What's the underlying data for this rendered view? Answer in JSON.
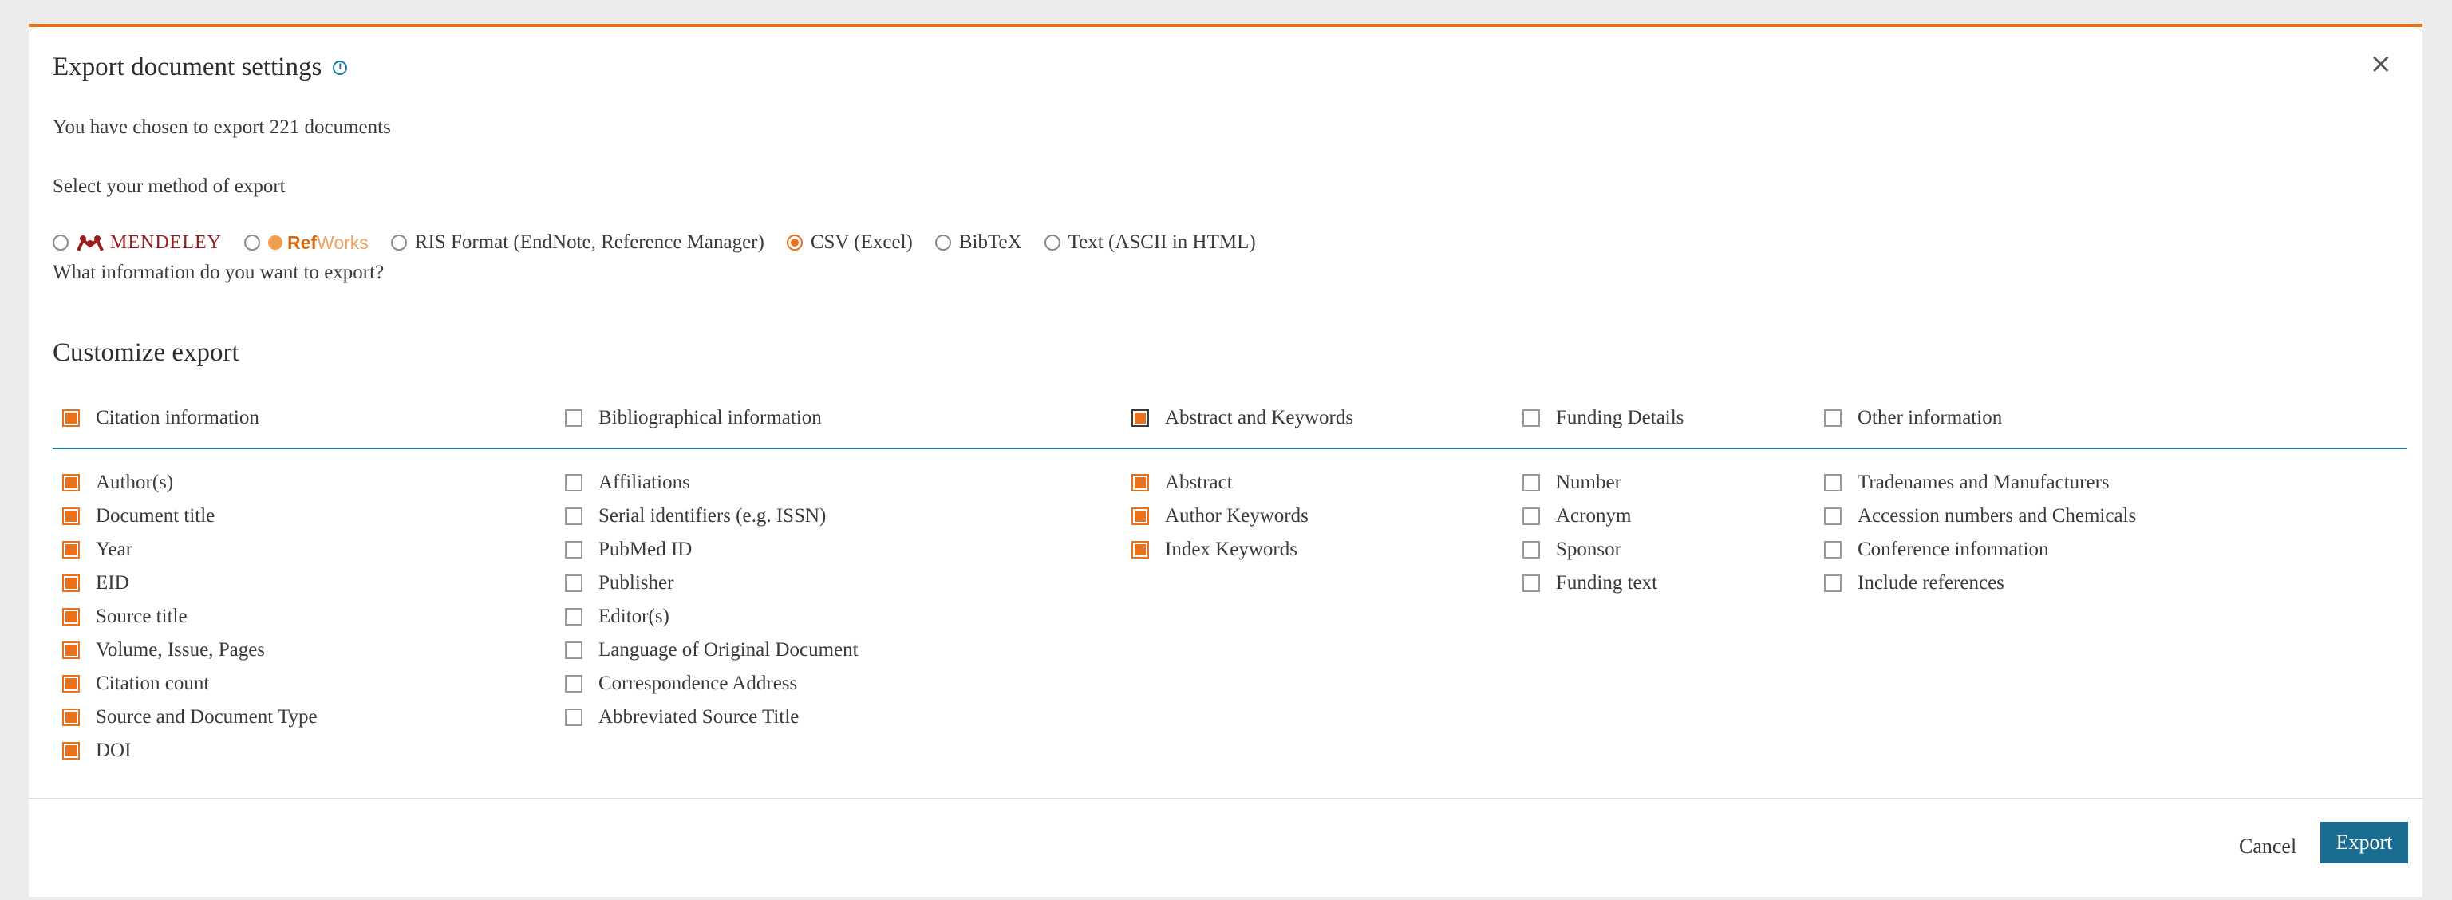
{
  "dialog": {
    "title": "Export document settings",
    "close_glyph": "×",
    "chosen_text": "You have chosen to export 221 documents",
    "select_method_text": "Select your method of export",
    "what_info_text": "What information do you want to export?",
    "customize_title": "Customize export"
  },
  "methods": {
    "mendeley": "MENDELEY",
    "refworks_ref": "Ref",
    "refworks_works": "Works",
    "ris": "RIS Format (EndNote, Reference Manager)",
    "csv": "CSV (Excel)",
    "bibtex": "BibTeX",
    "text": "Text (ASCII in HTML)",
    "selected": "CSV (Excel)"
  },
  "columns": {
    "citation": {
      "header": "Citation information",
      "checked": true,
      "items": [
        "Author(s)",
        "Document title",
        "Year",
        "EID",
        "Source title",
        "Volume, Issue, Pages",
        "Citation count",
        "Source and Document Type",
        "DOI"
      ]
    },
    "bibliographical": {
      "header": "Bibliographical information",
      "checked": false,
      "items": [
        "Affiliations",
        "Serial identifiers (e.g. ISSN)",
        "PubMed ID",
        "Publisher",
        "Editor(s)",
        "Language of Original Document",
        "Correspondence Address",
        "Abbreviated Source Title"
      ]
    },
    "abstract": {
      "header": "Abstract and Keywords",
      "checked": true,
      "items": [
        "Abstract",
        "Author Keywords",
        "Index Keywords"
      ]
    },
    "funding": {
      "header": "Funding Details",
      "checked": false,
      "items": [
        "Number",
        "Acronym",
        "Sponsor",
        "Funding text"
      ]
    },
    "other": {
      "header": "Other information",
      "checked": false,
      "items": [
        "Tradenames and Manufacturers",
        "Accession numbers and Chemicals",
        "Conference information",
        "Include references"
      ]
    }
  },
  "footer": {
    "cancel": "Cancel",
    "export": "Export"
  },
  "colors": {
    "accent_orange": "#e9711c",
    "primary_blue": "#1a6c91",
    "divider_blue": "#1f7aa8"
  }
}
